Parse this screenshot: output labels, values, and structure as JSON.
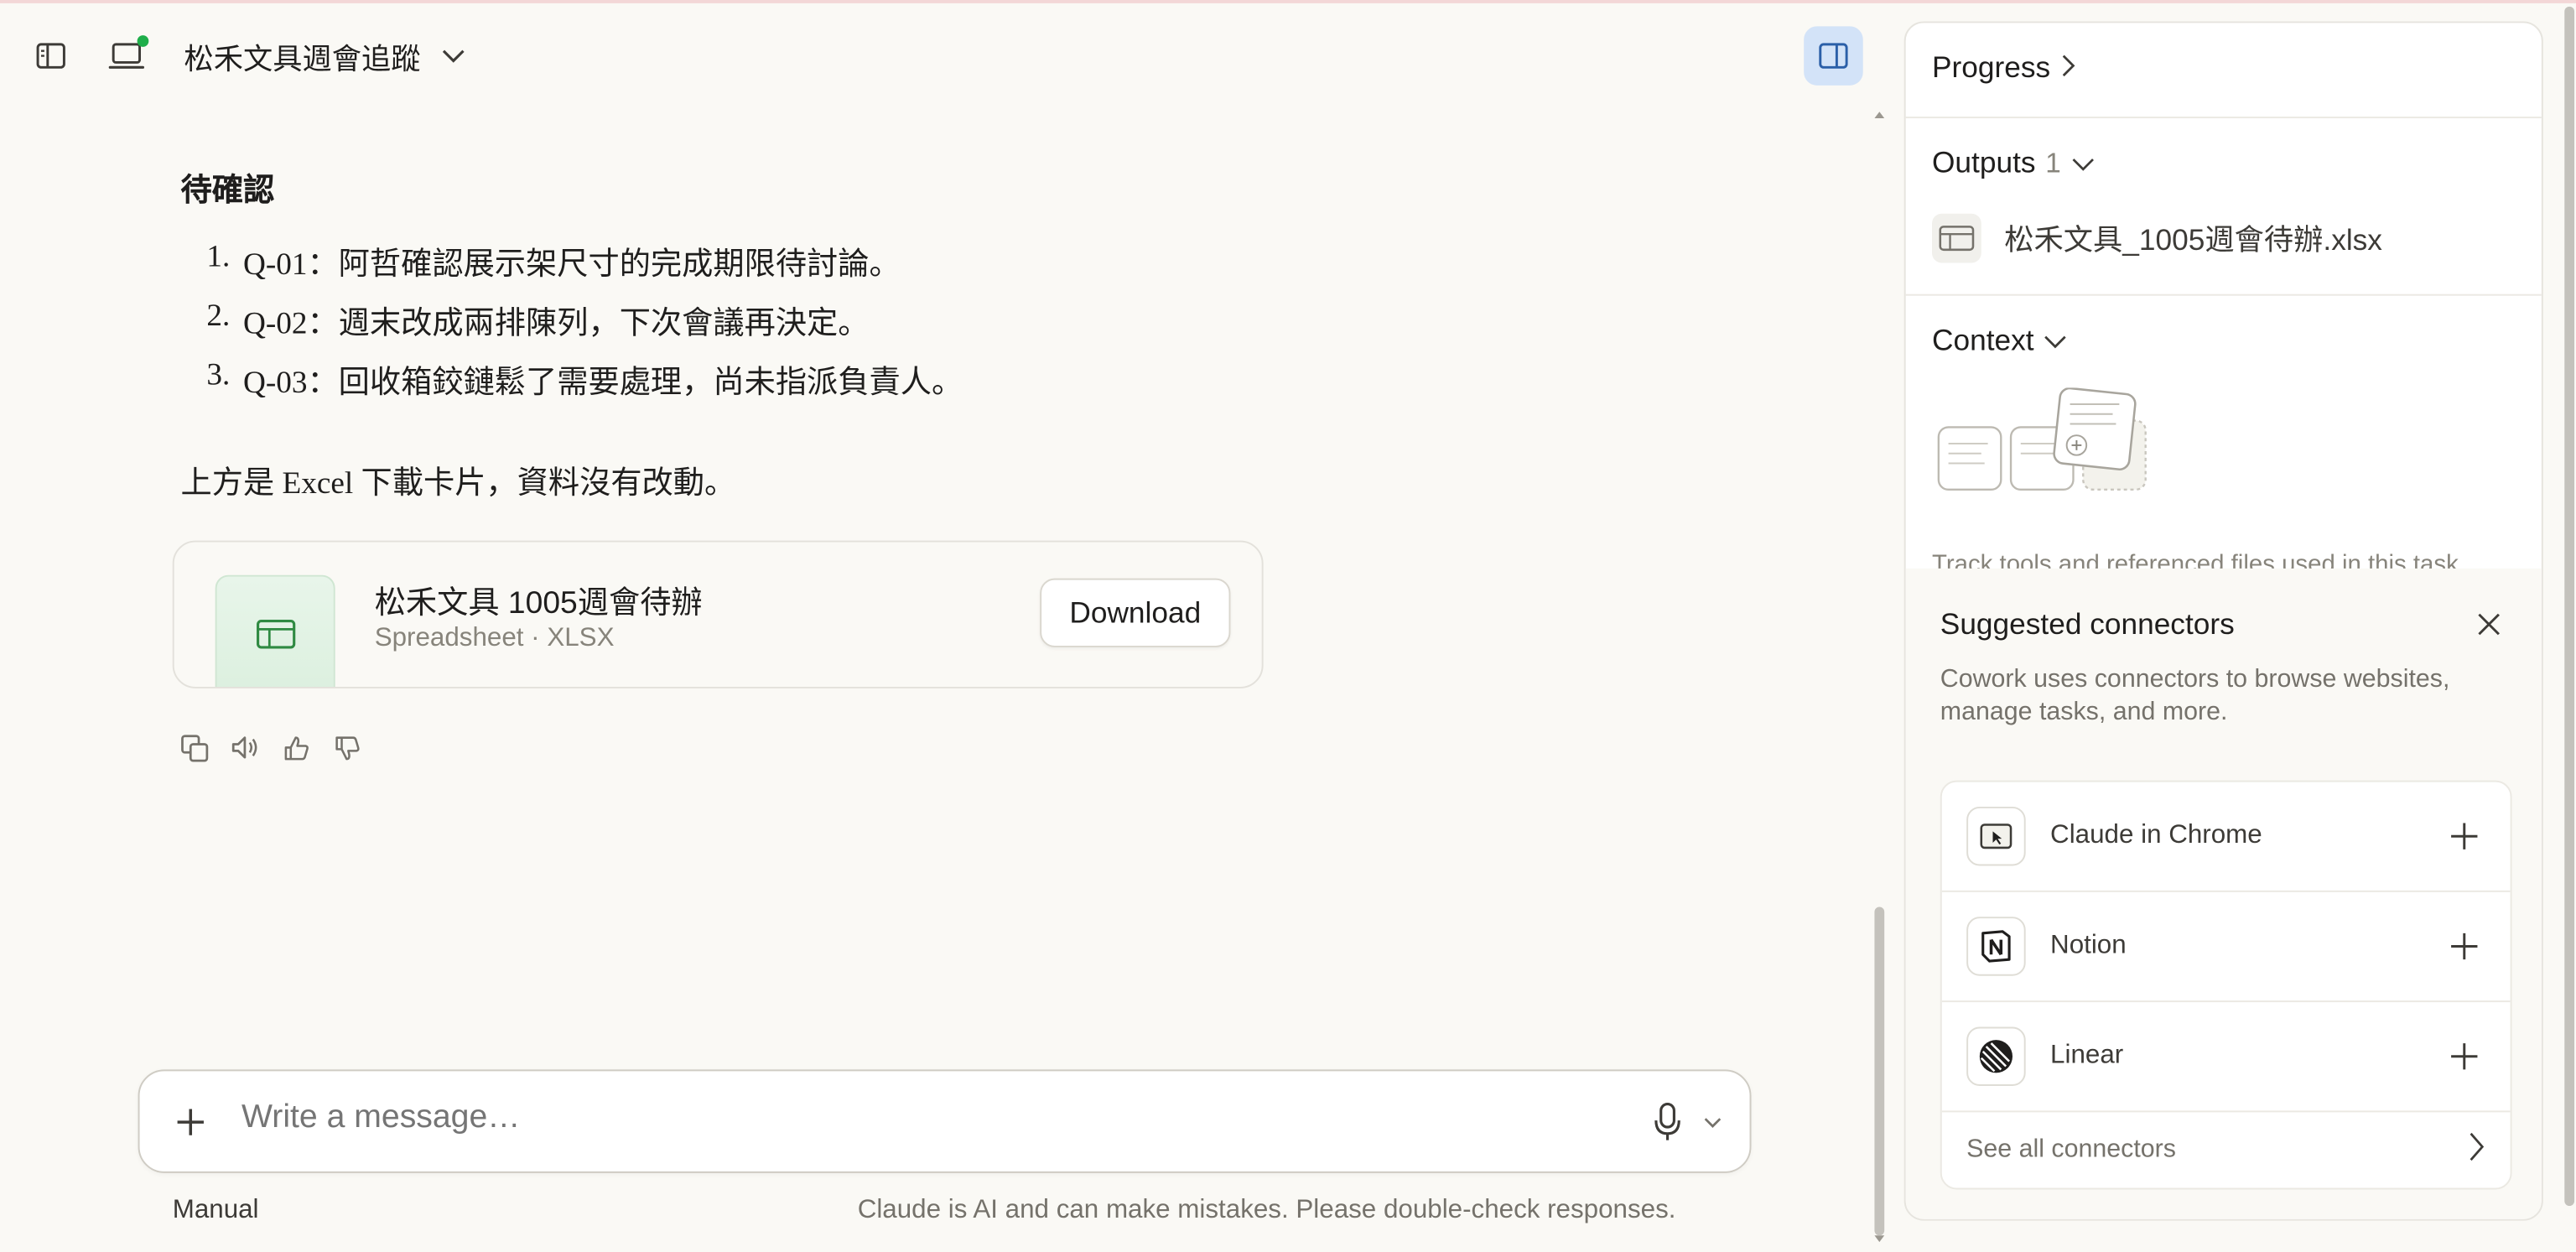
{
  "topbar": {
    "project_title": "松禾文具週會追蹤"
  },
  "content": {
    "section_heading": "待確認",
    "items": [
      {
        "num": "1.",
        "text": "Q-01：阿哲確認展示架尺寸的完成期限待討論。"
      },
      {
        "num": "2.",
        "text": "Q-02：週末改成兩排陳列，下次會議再決定。"
      },
      {
        "num": "3.",
        "text": "Q-03：回收箱鉸鏈鬆了需要處理，尚未指派負責人。"
      }
    ],
    "note": "上方是 Excel 下載卡片，資料沒有改動。",
    "file_card": {
      "name": "松禾文具 1005週會待辦",
      "type": "Spreadsheet · XLSX",
      "download_label": "Download"
    }
  },
  "composer": {
    "placeholder": "Write a message…",
    "mode": "Manual",
    "disclaimer": "Claude is AI and can make mistakes. Please double-check responses."
  },
  "panel": {
    "progress_label": "Progress",
    "outputs_label": "Outputs",
    "outputs_count": "1",
    "output_file": "松禾文具_1005週會待辦.xlsx",
    "context_label": "Context",
    "context_desc": "Track tools and referenced files used in this task.",
    "suggested": {
      "title": "Suggested connectors",
      "desc": "Cowork uses connectors to browse websites, manage tasks, and more.",
      "connectors": [
        {
          "name": "Claude in Chrome",
          "icon": "chrome-cursor-icon"
        },
        {
          "name": "Notion",
          "icon": "notion-icon"
        },
        {
          "name": "Linear",
          "icon": "linear-icon"
        }
      ],
      "see_all": "See all connectors"
    }
  },
  "colors": {
    "background": "#faf9f5",
    "accent_active": "#d3e3f8",
    "status_online": "#1fae4a",
    "spreadsheet_green": "#2f8a42"
  }
}
